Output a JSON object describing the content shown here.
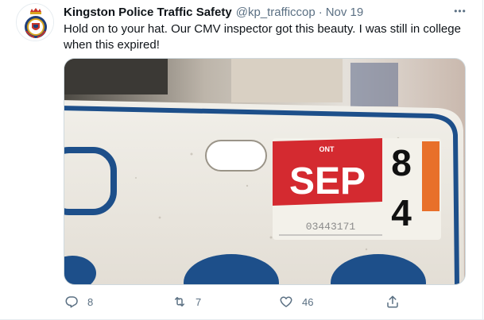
{
  "tweet": {
    "display_name": "Kingston Police Traffic Safety",
    "handle": "@kp_trafficcop",
    "separator": "·",
    "date": "Nov 19",
    "more_label": "•••",
    "text": "Hold on to your hat. Our CMV inspector got this beauty. I was still in college when this expired!",
    "image": {
      "subject": "old-ontario-license-plate",
      "sticker_province": "ONT",
      "sticker_month": "SEP",
      "sticker_year_top": "8",
      "sticker_year_bottom": "4",
      "sticker_serial": "03443171"
    },
    "actions": {
      "reply": {
        "icon": "reply-icon",
        "count": "8"
      },
      "retweet": {
        "icon": "retweet-icon",
        "count": "7"
      },
      "like": {
        "icon": "heart-icon",
        "count": "46"
      },
      "share": {
        "icon": "share-icon"
      }
    }
  },
  "colors": {
    "text_primary": "#0f1419",
    "text_secondary": "#5b7083",
    "plate_blue": "#1d4f8a",
    "sticker_red": "#d42a30",
    "sticker_orange": "#e8702a"
  }
}
